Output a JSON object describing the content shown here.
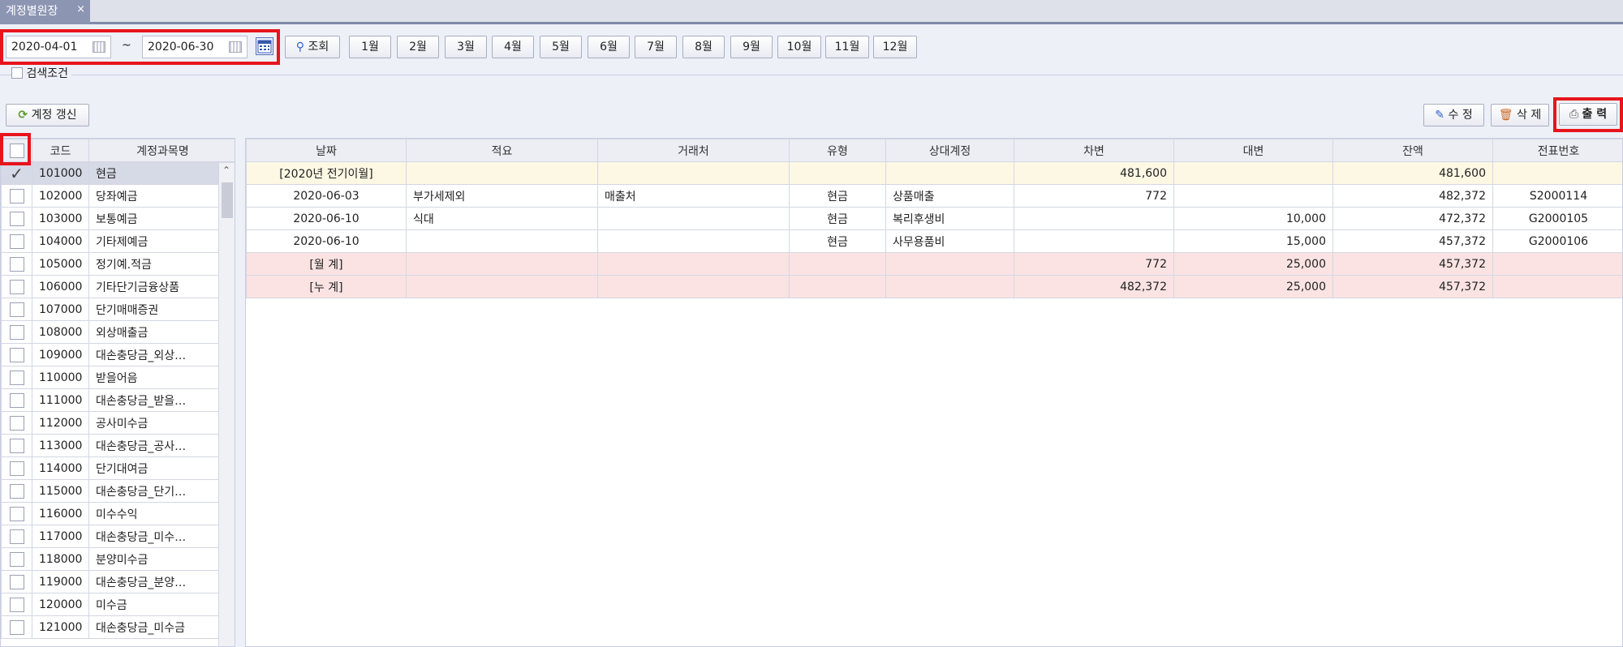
{
  "tab": {
    "title": "계정별원장",
    "close": "×"
  },
  "filter": {
    "date_from": "2020-04-01",
    "date_to": "2020-06-30",
    "tilde": "~",
    "search_label": "조회",
    "months": [
      "1월",
      "2월",
      "3월",
      "4월",
      "5월",
      "6월",
      "7월",
      "8월",
      "9월",
      "10월",
      "11월",
      "12월"
    ],
    "conditions_label": "검색조건"
  },
  "toolbar": {
    "refresh_label": "계정 갱신",
    "edit_label": "수 정",
    "delete_label": "삭 제",
    "print_label": "출 력"
  },
  "accounts": {
    "headers": {
      "code": "코드",
      "name": "계정과목명"
    },
    "rows": [
      {
        "code": "101000",
        "name": "현금"
      },
      {
        "code": "102000",
        "name": "당좌예금"
      },
      {
        "code": "103000",
        "name": "보통예금"
      },
      {
        "code": "104000",
        "name": "기타제예금"
      },
      {
        "code": "105000",
        "name": "정기예.적금"
      },
      {
        "code": "106000",
        "name": "기타단기금융상품"
      },
      {
        "code": "107000",
        "name": "단기매매증권"
      },
      {
        "code": "108000",
        "name": "외상매출금"
      },
      {
        "code": "109000",
        "name": "대손충당금_외상…"
      },
      {
        "code": "110000",
        "name": "받을어음"
      },
      {
        "code": "111000",
        "name": "대손충당금_받을…"
      },
      {
        "code": "112000",
        "name": "공사미수금"
      },
      {
        "code": "113000",
        "name": "대손충당금_공사…"
      },
      {
        "code": "114000",
        "name": "단기대여금"
      },
      {
        "code": "115000",
        "name": "대손충당금_단기…"
      },
      {
        "code": "116000",
        "name": "미수수익"
      },
      {
        "code": "117000",
        "name": "대손충당금_미수…"
      },
      {
        "code": "118000",
        "name": "분양미수금"
      },
      {
        "code": "119000",
        "name": "대손충당금_분양…"
      },
      {
        "code": "120000",
        "name": "미수금"
      },
      {
        "code": "121000",
        "name": "대손충당금_미수금"
      }
    ]
  },
  "ledger": {
    "headers": {
      "date": "날짜",
      "memo": "적요",
      "vendor": "거래처",
      "type": "유형",
      "counter": "상대계정",
      "debit": "차변",
      "credit": "대변",
      "balance": "잔액",
      "voucher": "전표번호"
    },
    "rows": [
      {
        "date": "[2020년 전기이월]",
        "memo": "",
        "vendor": "",
        "type": "",
        "counter": "",
        "debit": "481,600",
        "credit": "",
        "balance": "481,600",
        "voucher": ""
      },
      {
        "date": "2020-06-03",
        "memo": "부가세제외",
        "vendor": "매출처",
        "type": "현금",
        "counter": "상품매출",
        "debit": "772",
        "credit": "",
        "balance": "482,372",
        "voucher": "S2000114"
      },
      {
        "date": "2020-06-10",
        "memo": "식대",
        "vendor": "",
        "type": "현금",
        "counter": "복리후생비",
        "debit": "",
        "credit": "10,000",
        "balance": "472,372",
        "voucher": "G2000105"
      },
      {
        "date": "2020-06-10",
        "memo": "",
        "vendor": "",
        "type": "현금",
        "counter": "사무용품비",
        "debit": "",
        "credit": "15,000",
        "balance": "457,372",
        "voucher": "G2000106"
      },
      {
        "date": "[월 계]",
        "memo": "",
        "vendor": "",
        "type": "",
        "counter": "",
        "debit": "772",
        "credit": "25,000",
        "balance": "457,372",
        "voucher": ""
      },
      {
        "date": "[누 계]",
        "memo": "",
        "vendor": "",
        "type": "",
        "counter": "",
        "debit": "482,372",
        "credit": "25,000",
        "balance": "457,372",
        "voucher": ""
      }
    ]
  },
  "colors": {
    "carry_row": "#fdf8e4",
    "summary_row": "#fbe3e3",
    "selected_row": "#d6d9e6",
    "highlight": "#e8141c"
  }
}
